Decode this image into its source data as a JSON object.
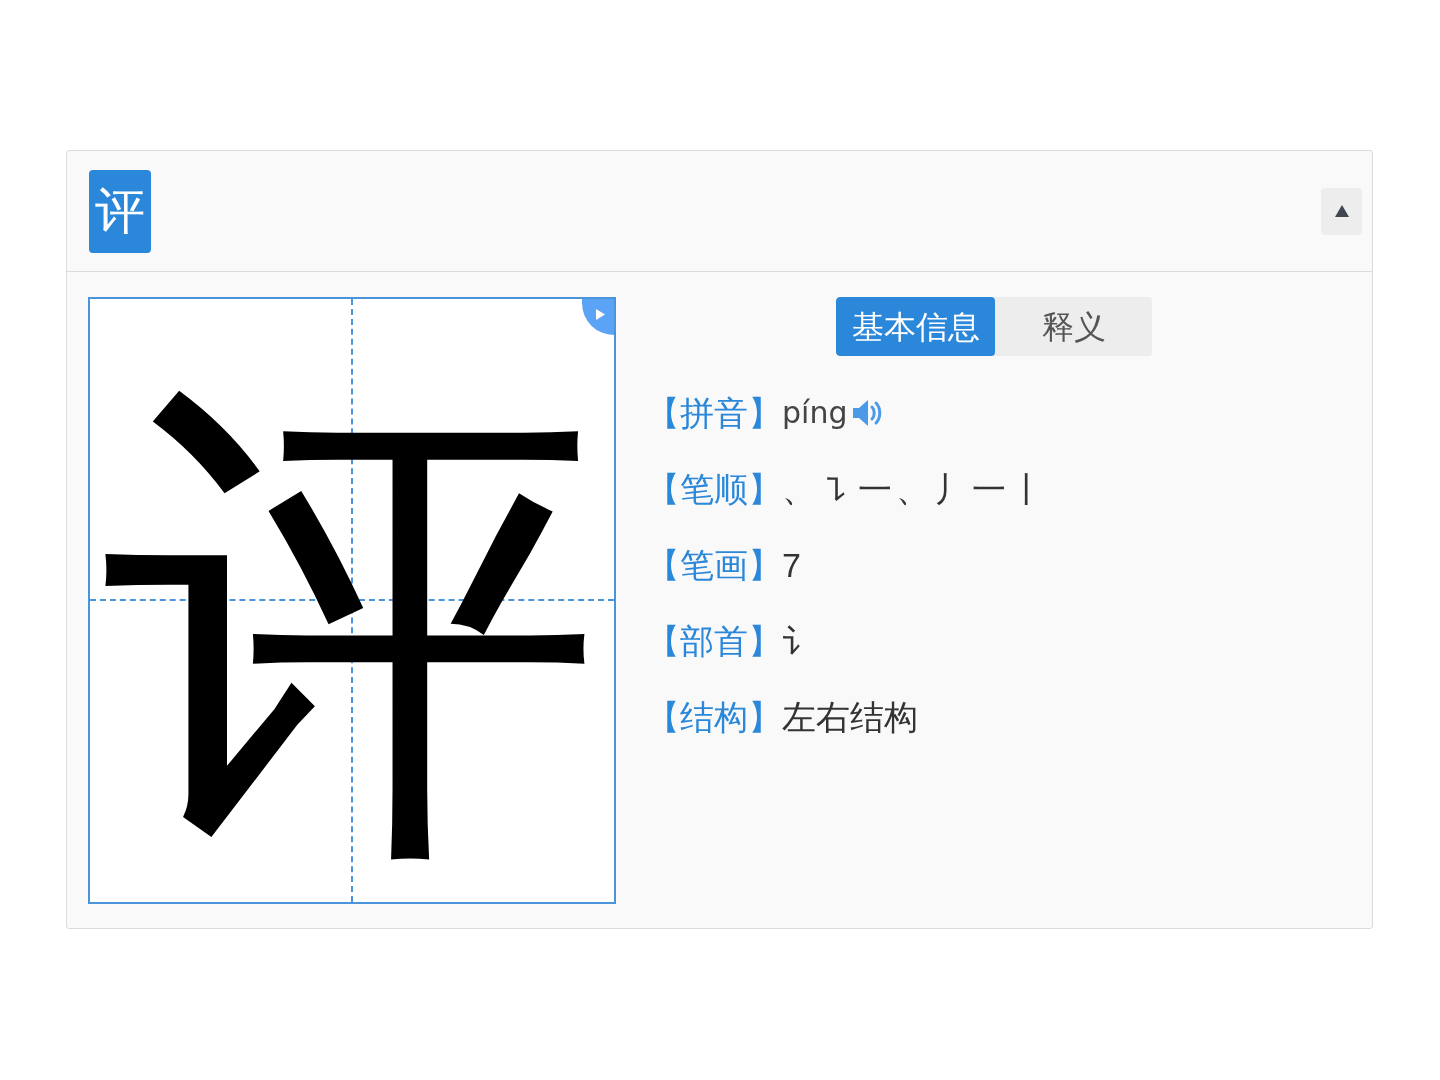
{
  "header": {
    "character": "评"
  },
  "character_box": {
    "character": "评"
  },
  "tabs": [
    {
      "label": "基本信息",
      "selected": true
    },
    {
      "label": "释义",
      "selected": false
    }
  ],
  "info": [
    {
      "kind": "audio",
      "label": "【拼音】",
      "value": "píng"
    },
    {
      "kind": "text",
      "label": "【笔顺】",
      "value": "、㇊一、丿一丨"
    },
    {
      "kind": "text",
      "label": "【笔画】",
      "value": "7"
    },
    {
      "kind": "text",
      "label": "【部首】",
      "value": "讠"
    },
    {
      "kind": "text",
      "label": "【结构】",
      "value": "左右结构"
    }
  ]
}
